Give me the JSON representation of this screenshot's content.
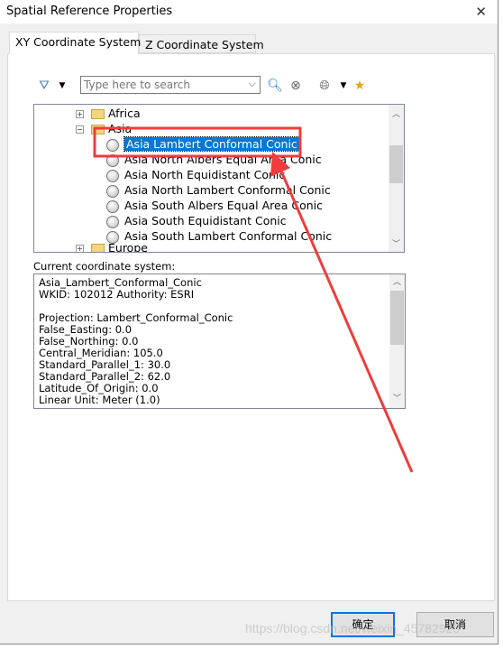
{
  "window": {
    "title": "Spatial Reference Properties"
  },
  "tabs": [
    {
      "label": "XY Coordinate System",
      "active": true
    },
    {
      "label": "Z Coordinate System",
      "active": false
    }
  ],
  "toolbar": {
    "search_placeholder": "Type here to search",
    "icons": [
      "filter-icon",
      "search-icon",
      "clear-search-icon",
      "globe-icon",
      "add-favorite-icon"
    ]
  },
  "tree": {
    "nodes": [
      {
        "label": "Africa",
        "type": "folder",
        "expander": "+"
      },
      {
        "label": "Asia",
        "type": "folder",
        "expander": "-"
      },
      {
        "label": "Asia Lambert Conformal Conic",
        "type": "projection",
        "selected": true
      },
      {
        "label": "Asia North Albers Equal Area Conic",
        "type": "projection"
      },
      {
        "label": "Asia North Equidistant Conic",
        "type": "projection"
      },
      {
        "label": "Asia North Lambert Conformal Conic",
        "type": "projection"
      },
      {
        "label": "Asia South Albers Equal Area Conic",
        "type": "projection"
      },
      {
        "label": "Asia South Equidistant Conic",
        "type": "projection"
      },
      {
        "label": "Asia South Lambert Conformal Conic",
        "type": "projection"
      },
      {
        "label": "Europe",
        "type": "folder",
        "expander": "+"
      }
    ]
  },
  "current": {
    "label": "Current coordinate system:",
    "lines": [
      "Asia_Lambert_Conformal_Conic",
      "WKID: 102012 Authority: ESRI",
      "",
      "Projection: Lambert_Conformal_Conic",
      "False_Easting: 0.0",
      "False_Northing: 0.0",
      "Central_Meridian: 105.0",
      "Standard_Parallel_1: 30.0",
      "Standard_Parallel_2: 62.0",
      "Latitude_Of_Origin: 0.0",
      "Linear Unit: Meter (1.0)"
    ]
  },
  "buttons": {
    "ok": "确定",
    "cancel": "取消"
  },
  "watermark": "https://blog.csdn.net/weixin_45782925",
  "colors": {
    "selection": "#0078d7",
    "annotation": "#f03c3c"
  }
}
